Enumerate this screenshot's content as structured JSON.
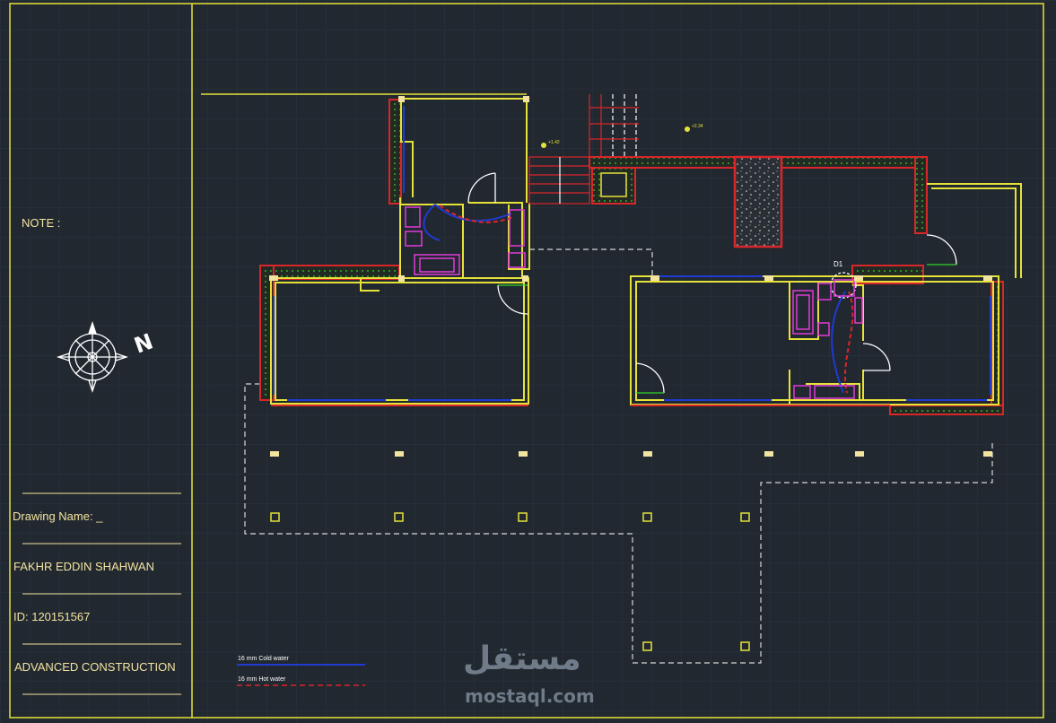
{
  "title_block": {
    "note_label": "NOTE :",
    "drawing_name": "Drawing Name: _",
    "author": "FAKHR EDDIN SHAHWAN",
    "id": "ID: 120151567",
    "course": "ADVANCED CONSTRUCTION"
  },
  "compass": {
    "label": "N"
  },
  "legend": {
    "cold_label": "16 mm Cold water",
    "hot_label": "16 mm Hot water",
    "cold_color": "#1f3bd1",
    "hot_color": "#d9262b"
  },
  "tags": {
    "door_d1": "D1",
    "level_1": "+1.42",
    "level_2": "+2.34"
  },
  "watermark": {
    "arabic": "مستقل",
    "latin": "mostaql.com"
  },
  "colors": {
    "background": "#212830",
    "wall": "#e6e23a",
    "insulation": "#d9262b",
    "fixture": "#e03ad8",
    "door": "#ffffff",
    "dashed": "#d6d6d6",
    "grid": "#2b3440"
  }
}
